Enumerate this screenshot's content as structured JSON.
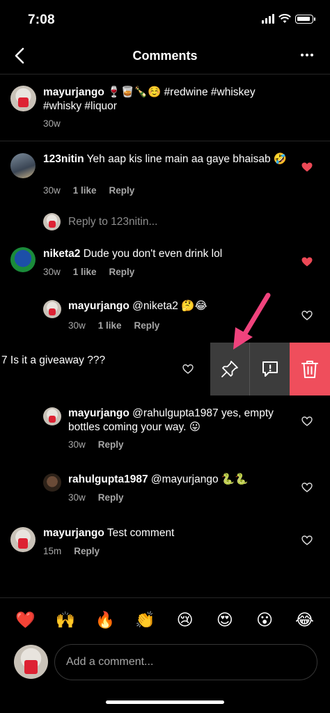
{
  "status_bar": {
    "time": "7:08"
  },
  "header": {
    "title": "Comments"
  },
  "caption": {
    "username": "mayurjango",
    "text": "🍷🥃🍾☺️ #redwine #whiskey #whisky #liquor",
    "time": "30w"
  },
  "comments": [
    {
      "username": "123nitin",
      "text": "Yeh aap kis line main aa gaye bhaisab 🤣",
      "time": "30w",
      "likes": "1 like",
      "reply": "Reply",
      "liked": true
    },
    {
      "username": "niketa2",
      "text": "Dude you don't even drink lol",
      "time": "30w",
      "likes": "1 like",
      "reply": "Reply",
      "liked": true
    },
    {
      "username": "mayurjango",
      "text": "@niketa2 🤔😂",
      "time": "30w",
      "likes": "1 like",
      "reply": "Reply",
      "liked": false
    },
    {
      "username": "",
      "text": "7 Is it a giveaway ???",
      "time": "",
      "likes": "",
      "reply": "",
      "liked": false
    },
    {
      "username": "mayurjango",
      "text": "@rahulgupta1987 yes, empty bottles coming your way. 😛",
      "time": "30w",
      "likes": "",
      "reply": "Reply",
      "liked": false
    },
    {
      "username": "rahulgupta1987",
      "text": "@mayurjango 🐍🐍",
      "time": "30w",
      "likes": "",
      "reply": "Reply",
      "liked": false
    },
    {
      "username": "mayurjango",
      "text": "Test comment",
      "time": "15m",
      "likes": "",
      "reply": "Reply",
      "liked": false
    }
  ],
  "reply_prompt": "Reply to 123nitin...",
  "emoji_bar": [
    "❤️",
    "🙌",
    "🔥",
    "👏",
    "😢",
    "😍",
    "😮",
    "😂"
  ],
  "composer": {
    "placeholder": "Add a comment..."
  },
  "colors": {
    "background": "#000000",
    "liked_heart": "#ed4956",
    "delete_action": "#ef4e5c",
    "annotation_arrow": "#f0437d"
  },
  "icons": [
    "back-arrow-icon",
    "more-icon",
    "heart-icon",
    "pin-icon",
    "report-icon",
    "trash-icon"
  ]
}
